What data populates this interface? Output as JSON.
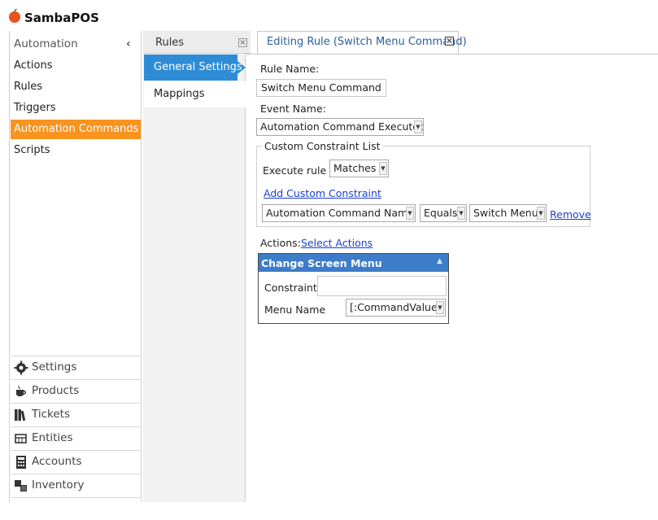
{
  "app": {
    "name": "SambaPOS"
  },
  "nav": {
    "section_title": "Automation",
    "collapse_glyph": "‹",
    "items": [
      {
        "label": "Actions",
        "active": false
      },
      {
        "label": "Rules",
        "active": false
      },
      {
        "label": "Triggers",
        "active": false
      },
      {
        "label": "Automation Commands",
        "active": true
      },
      {
        "label": "Scripts",
        "active": false
      }
    ],
    "modules": [
      {
        "label": "Settings",
        "icon": "gear-icon"
      },
      {
        "label": "Products",
        "icon": "cup-icon"
      },
      {
        "label": "Tickets",
        "icon": "books-icon"
      },
      {
        "label": "Entities",
        "icon": "table-icon"
      },
      {
        "label": "Accounts",
        "icon": "calculator-icon"
      },
      {
        "label": "Inventory",
        "icon": "boxes-icon"
      }
    ]
  },
  "list_tab": {
    "label": "Rules",
    "close": "×"
  },
  "sections": {
    "general": "General Settings",
    "mappings": "Mappings"
  },
  "editor": {
    "tab_label": "Editing Rule (Switch Menu Command)",
    "tab_close": "×",
    "rule_name_label": "Rule Name:",
    "rule_name_value": "Switch Menu Command",
    "event_name_label": "Event Name:",
    "event_name_value": "Automation Command Executed",
    "constraint_list_title": "Custom Constraint List",
    "execute_rule_label": "Execute rule if",
    "execute_rule_value": "Matches",
    "add_constraint_link": "Add Custom Constraint",
    "constraint": {
      "field": "Automation Command Name",
      "operator": "Equals",
      "value": "Switch Menu",
      "remove_link": "Remove"
    },
    "actions_label": "Actions:",
    "select_actions_link": "Select Actions",
    "action_card": {
      "title": "Change Screen Menu",
      "constraint_label": "Constraint:",
      "constraint_value": "",
      "menu_name_label": "Menu Name",
      "menu_name_value": "[:CommandValue]"
    }
  }
}
